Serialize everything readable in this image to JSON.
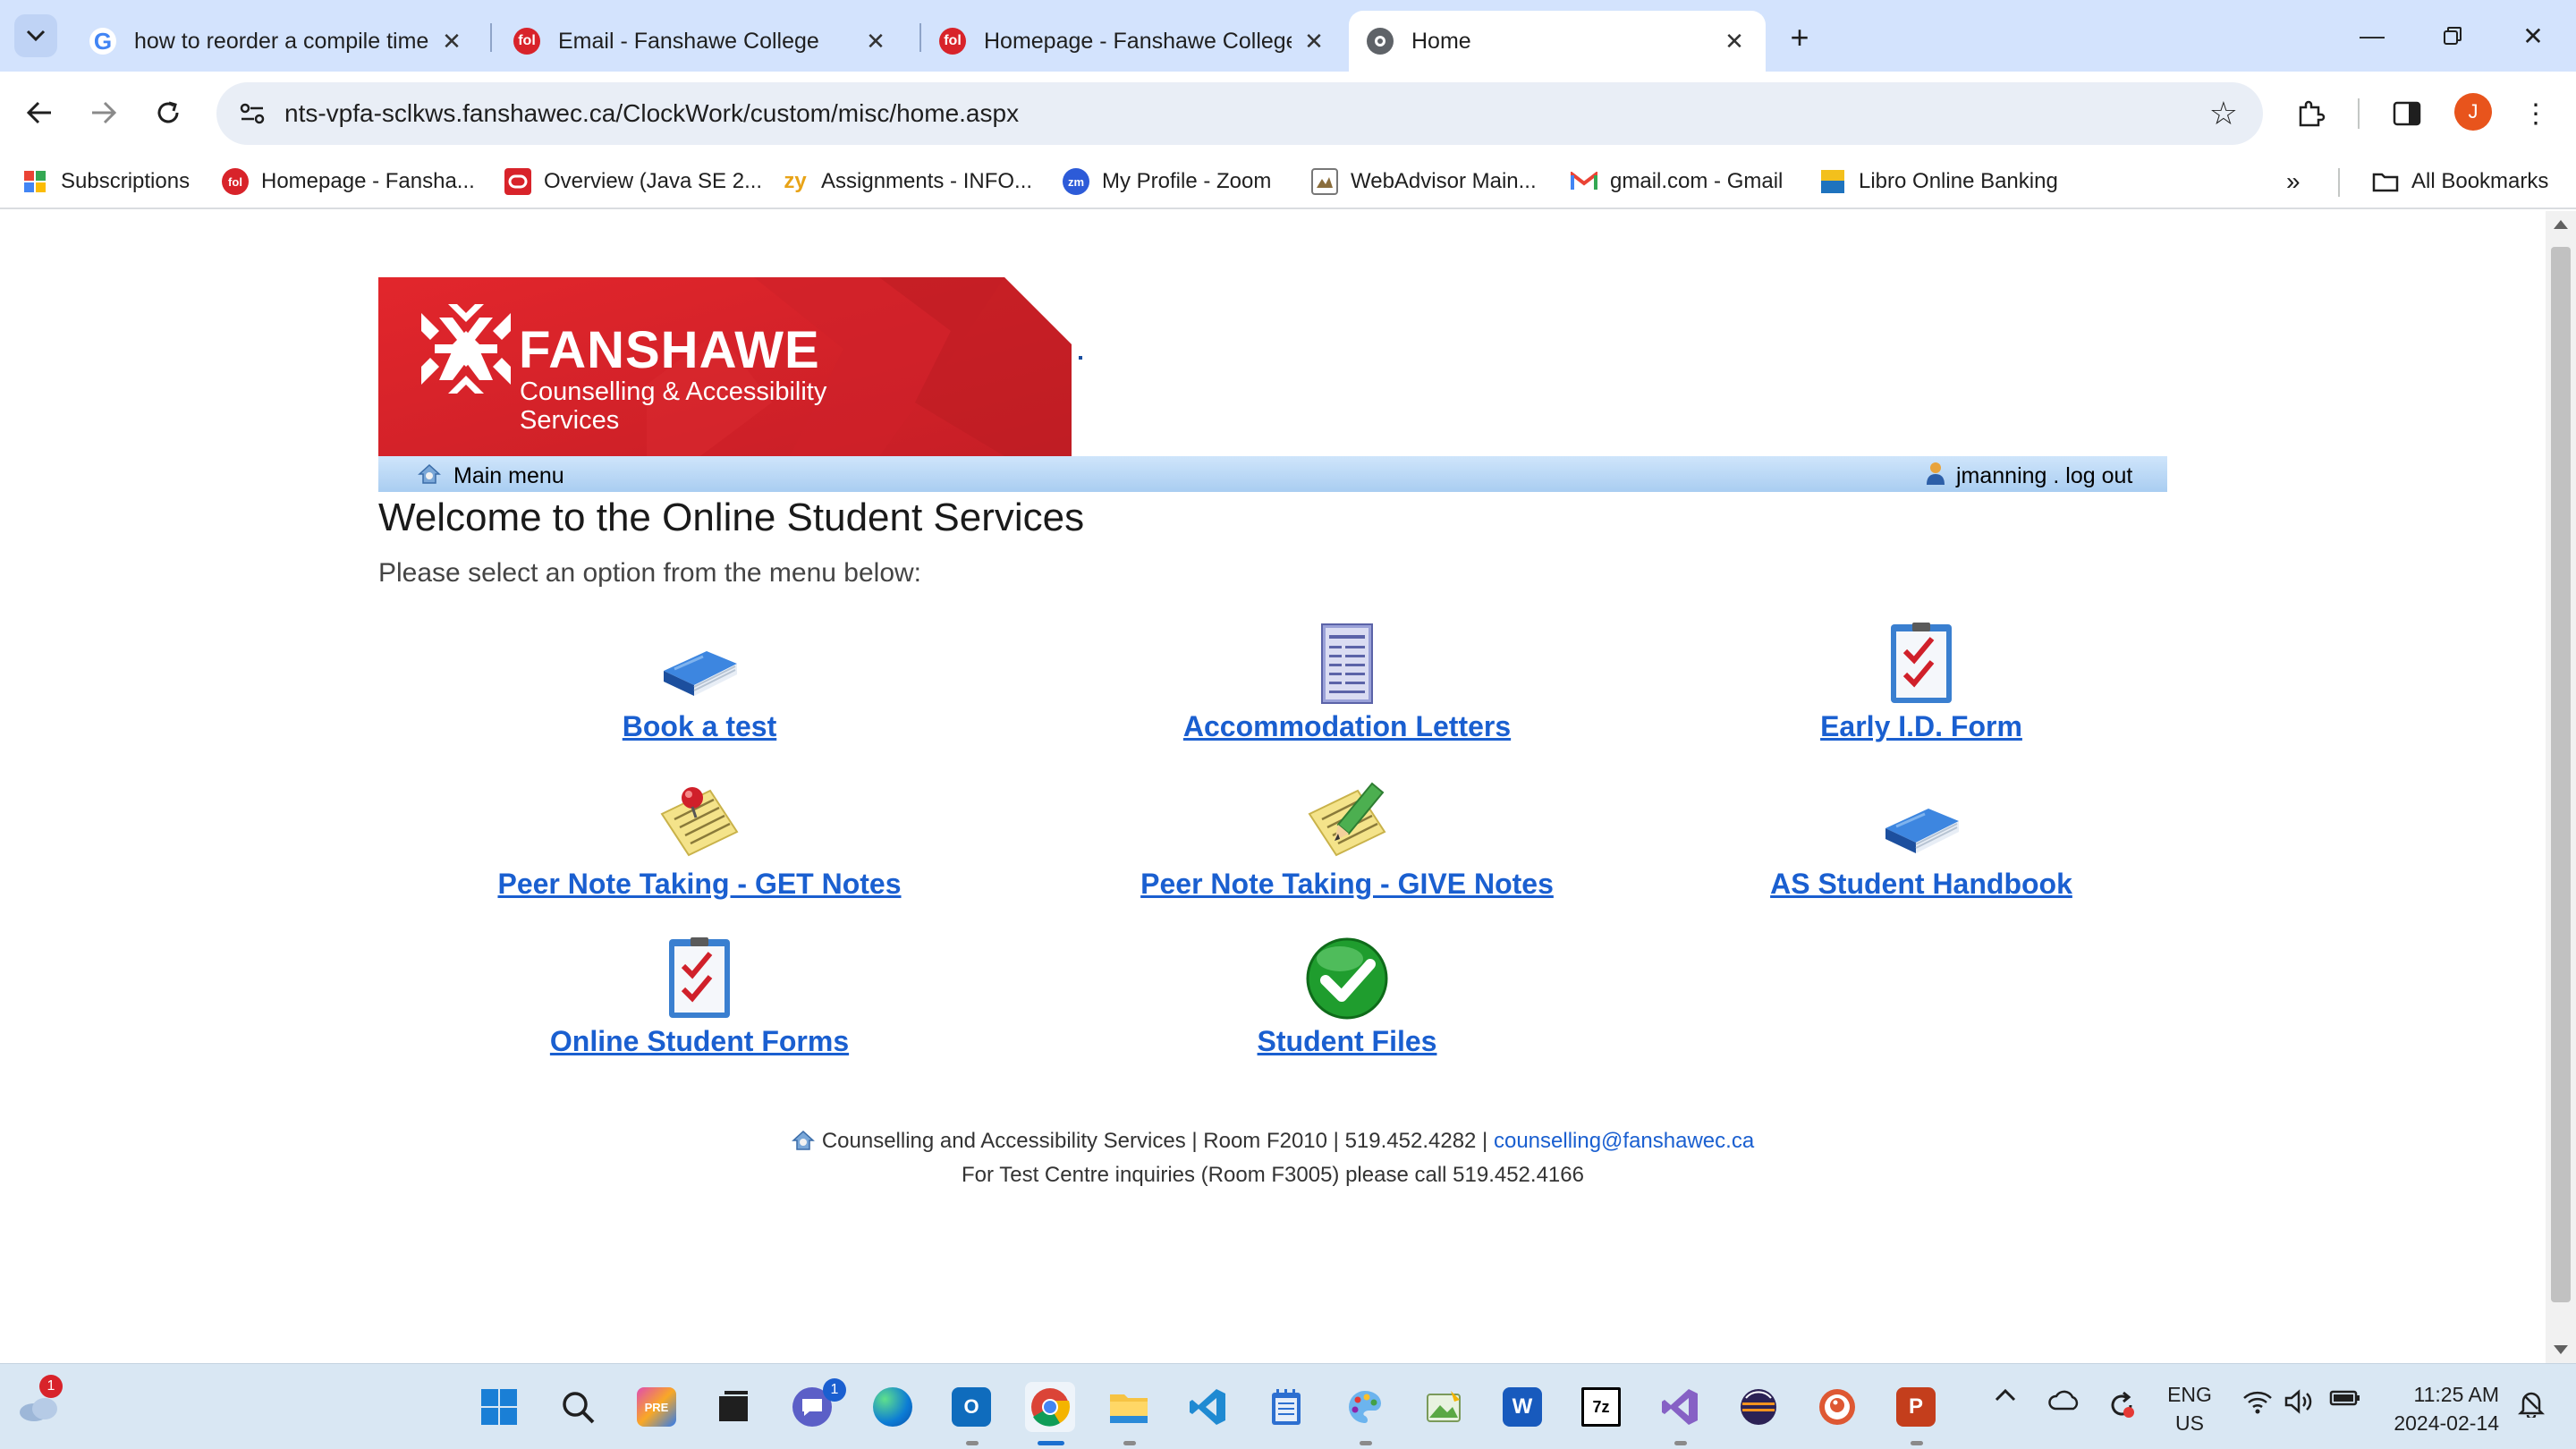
{
  "browser": {
    "tabs": [
      {
        "title": "how to reorder a compile time",
        "favicon": "google-icon",
        "active": false
      },
      {
        "title": "Email - Fanshawe College",
        "favicon": "fanshawe-fol-icon",
        "active": false
      },
      {
        "title": "Homepage - Fanshawe College",
        "favicon": "fanshawe-fol-icon",
        "active": false
      },
      {
        "title": "Home",
        "favicon": "globe-icon",
        "active": true
      }
    ],
    "url": "nts-vpfa-sclkws.fanshawec.ca/ClockWork/custom/misc/home.aspx",
    "profile_initial": "J",
    "bookmarks": [
      {
        "label": "Subscriptions",
        "icon": "subscriptions-icon"
      },
      {
        "label": "Homepage - Fansha...",
        "icon": "fanshawe-fol-icon"
      },
      {
        "label": "Overview (Java SE 2...",
        "icon": "oracle-icon"
      },
      {
        "label": "Assignments - INFO...",
        "icon": "zybooks-icon"
      },
      {
        "label": "My Profile - Zoom",
        "icon": "zoom-icon"
      },
      {
        "label": "WebAdvisor Main...",
        "icon": "webadvisor-icon"
      },
      {
        "label": "gmail.com - Gmail",
        "icon": "gmail-icon"
      },
      {
        "label": "Libro Online Banking",
        "icon": "libro-icon"
      }
    ],
    "all_bookmarks": "All Bookmarks"
  },
  "page": {
    "banner": {
      "brand": "FANSHAWE",
      "subtitle_line1": "Counselling & Accessibility",
      "subtitle_line2": "Services"
    },
    "menubar": {
      "main_menu": "Main menu",
      "user": "jmanning . log out"
    },
    "welcome": "Welcome to the Online Student Services",
    "instruction": "Please select an option from the menu below:",
    "options": [
      {
        "label": "Book a test",
        "icon": "blue-book-icon"
      },
      {
        "label": "Accommodation Letters",
        "icon": "document-list-icon"
      },
      {
        "label": "Early I.D. Form",
        "icon": "checklist-icon"
      },
      {
        "label": "Peer Note Taking - GET Notes",
        "icon": "notepad-pin-icon"
      },
      {
        "label": "Peer Note Taking - GIVE Notes",
        "icon": "notepad-pencil-icon"
      },
      {
        "label": "AS Student Handbook",
        "icon": "blue-book-icon"
      },
      {
        "label": "Online Student Forms",
        "icon": "checklist-icon"
      },
      {
        "label": "Student Files",
        "icon": "green-check-icon"
      }
    ],
    "footer": {
      "contact": "Counselling and Accessibility Services | Room F2010 | 519.452.4282 |",
      "email": "counselling@fanshawec.ca",
      "test_centre": "For Test Centre inquiries (Room F3005) please call 519.452.4166"
    }
  },
  "taskbar": {
    "weather_badge": "1",
    "teams_badge": "1",
    "language_line1": "ENG",
    "language_line2": "US",
    "time": "11:25 AM",
    "date": "2024-02-14"
  },
  "colors": {
    "fanshawe_red": "#d8232a",
    "link_blue": "#1a5fd0",
    "tabstrip_bg": "#d3e3fd",
    "menubar_blue": "#a9cdf1"
  }
}
